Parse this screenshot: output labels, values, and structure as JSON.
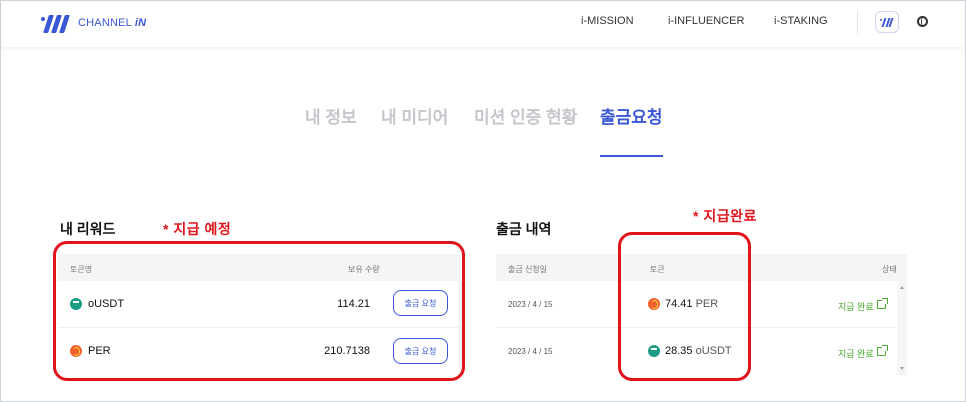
{
  "brand": {
    "name_plain": "CHANNEL ",
    "name_bold": "iN"
  },
  "nav": [
    "i-MISSION",
    "i-INFLUENCER",
    "i-STAKING"
  ],
  "tabs": [
    "내 정보",
    "내 미디어",
    "미션 인증 현황",
    "출금요청"
  ],
  "active_tab": "출금요청",
  "rewards": {
    "title": "내 리워드",
    "annotation": "* 지급 예정",
    "columns": {
      "token": "토큰명",
      "amount": "보유 수량"
    },
    "rows": [
      {
        "token": "oUSDT",
        "icon": "ousdt-token-icon",
        "amount": "114.21",
        "button": "출금 요청"
      },
      {
        "token": "PER",
        "icon": "per-token-icon",
        "amount": "210.7138",
        "button": "출금 요청"
      }
    ]
  },
  "history": {
    "title": "출금 내역",
    "annotation": "* 지급완료",
    "columns": {
      "date": "출금 신청일",
      "token": "토큰",
      "status": "상태"
    },
    "rows": [
      {
        "date": "2023 / 4 / 15",
        "amount": "74.41",
        "token": "PER",
        "icon": "per-token-icon",
        "status": "지급 완료"
      },
      {
        "date": "2023 / 4 / 15",
        "amount": "28.35",
        "token": "oUSDT",
        "icon": "ousdt-token-icon",
        "status": "지급 완료"
      }
    ]
  },
  "colors": {
    "accent": "#3a57d6",
    "annotation_red": "#e0141b",
    "status_green": "#45a82a",
    "ousdt": "#1c9c84",
    "per": "#f0622a"
  }
}
